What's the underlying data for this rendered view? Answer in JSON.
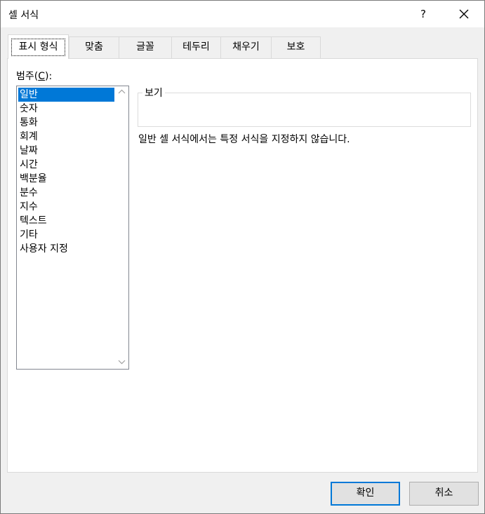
{
  "dialog": {
    "title": "셀 서식",
    "help_label": "?"
  },
  "tabs": [
    {
      "label": "표시 형식",
      "active": true
    },
    {
      "label": "맞춤"
    },
    {
      "label": "글꼴"
    },
    {
      "label": "테두리"
    },
    {
      "label": "채우기"
    },
    {
      "label": "보호"
    }
  ],
  "category": {
    "label": "범주",
    "accelerator": "C",
    "items": [
      "일반",
      "숫자",
      "통화",
      "회계",
      "날짜",
      "시간",
      "백분율",
      "분수",
      "지수",
      "텍스트",
      "기타",
      "사용자 지정"
    ],
    "selected": "일반"
  },
  "preview": {
    "label": "보기",
    "value": ""
  },
  "description": "일반 셀 서식에서는 특정 서식을 지정하지 않습니다.",
  "buttons": {
    "ok": "확인",
    "cancel": "취소"
  },
  "colors": {
    "accent": "#0078d7",
    "dialog_bg": "#f0f0f0"
  }
}
